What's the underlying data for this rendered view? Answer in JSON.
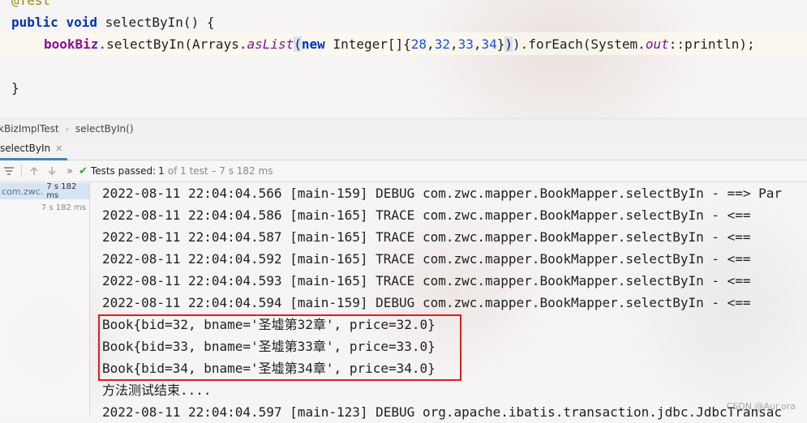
{
  "editor": {
    "line_annotation": "@Test",
    "line_method": {
      "kw1": "public",
      "kw2": "void",
      "name": " selectByIn() {"
    },
    "line_call": {
      "field": "bookBiz",
      "p1": ".selectByIn(Arrays.",
      "aslist": "asList",
      "p2": "(",
      "kw_new": "new",
      "p3": " Integer[]{",
      "n1": "28",
      "c1": ",",
      "n2": "32",
      "c2": ",",
      "n3": "33",
      "c3": ",",
      "n4": "34",
      "p4": "}",
      "p5": ")",
      "p6": ").forEach(System.",
      "out": "out",
      "p7": "::println);"
    },
    "line_close": "}"
  },
  "breadcrumb": {
    "class": "kBizImplTest",
    "sep": "›",
    "method": "selectByIn()"
  },
  "run_tab": {
    "label": "selectByIn",
    "close": "✕"
  },
  "toolbar": {
    "status_prefix": "Tests passed: ",
    "passed": "1",
    "status_suffix": "of 1 test – 7 s 182 ms",
    "more": "»"
  },
  "tree": {
    "row1_name": "com.zwc.",
    "row1_time": "7 s 182 ms",
    "row2_time": "7 s 182 ms"
  },
  "console": {
    "lines": [
      "2022-08-11 22:04:04.566 [main-159] DEBUG com.zwc.mapper.BookMapper.selectByIn - ==> Par",
      "2022-08-11 22:04:04.586 [main-165] TRACE com.zwc.mapper.BookMapper.selectByIn - <==",
      "2022-08-11 22:04:04.587 [main-165] TRACE com.zwc.mapper.BookMapper.selectByIn - <==",
      "2022-08-11 22:04:04.592 [main-165] TRACE com.zwc.mapper.BookMapper.selectByIn - <==",
      "2022-08-11 22:04:04.593 [main-165] TRACE com.zwc.mapper.BookMapper.selectByIn - <==",
      "2022-08-11 22:04:04.594 [main-159] DEBUG com.zwc.mapper.BookMapper.selectByIn - <==",
      "Book{bid=32, bname='圣墟第32章', price=32.0}",
      "Book{bid=33, bname='圣墟第33章', price=33.0}",
      "Book{bid=34, bname='圣墟第34章', price=34.0}",
      "方法测试结束....",
      "2022-08-11 22:04:04.597 [main-123] DEBUG org.apache.ibatis.transaction.jdbc.JdbcTransac"
    ],
    "watermark": "CSDN @Aur.ora"
  }
}
